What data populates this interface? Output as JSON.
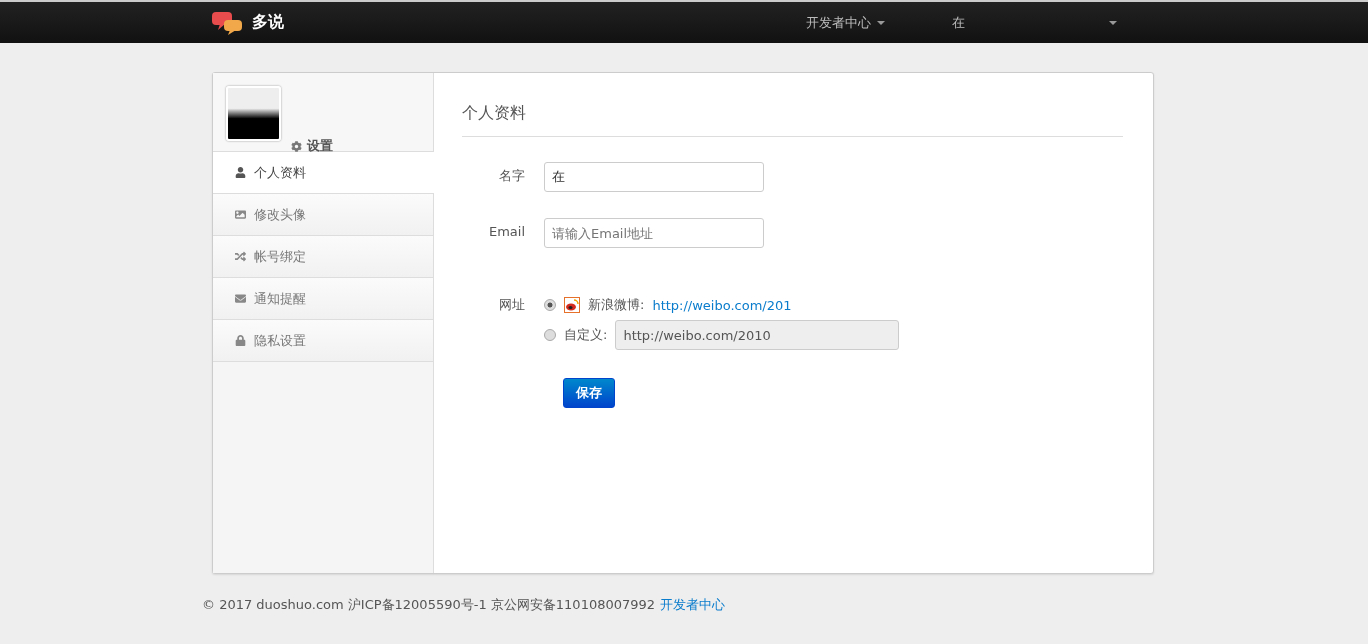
{
  "navbar": {
    "brand": "多说",
    "menus": [
      {
        "label": "开发者中心"
      },
      {
        "label": "在"
      }
    ]
  },
  "sidebar": {
    "settings_label": "设置",
    "items": [
      {
        "label": "个人资料",
        "selected": true
      },
      {
        "label": "修改头像",
        "selected": false
      },
      {
        "label": "帐号绑定",
        "selected": false
      },
      {
        "label": "通知提醒",
        "selected": false
      },
      {
        "label": "隐私设置",
        "selected": false
      }
    ]
  },
  "form": {
    "title": "个人资料",
    "name": {
      "label": "名字",
      "value": "在"
    },
    "email": {
      "label": "Email",
      "placeholder": "请输入Email地址"
    },
    "url": {
      "label": "网址",
      "options": [
        {
          "kind": "weibo",
          "label": "新浪微博:",
          "link": "http://weibo.com/201",
          "selected": true
        },
        {
          "kind": "custom",
          "label": "自定义:",
          "value": "http://weibo.com/2010",
          "selected": false
        }
      ]
    },
    "save_button": "保存"
  },
  "footer": {
    "text": "© 2017 duoshuo.com 沪ICP备12005590号-1 京公网安备110108007992",
    "link": "开发者中心"
  }
}
